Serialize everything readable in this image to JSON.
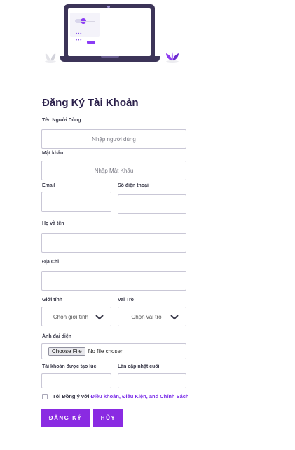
{
  "title": "Đăng Ký Tài Khoản",
  "fields": {
    "username": {
      "label": "Tên Người Dùng",
      "placeholder": "Nhập người dùng"
    },
    "password": {
      "label": "Mật khẩu",
      "placeholder": "Nhập Mật Khẩu"
    },
    "email": {
      "label": "Email",
      "value": ""
    },
    "phone": {
      "label": "Số điện thoại",
      "value": ""
    },
    "fullname": {
      "label": "Họ và tên",
      "value": ""
    },
    "address": {
      "label": "Địa Chỉ",
      "value": ""
    },
    "gender": {
      "label": "Giới tính",
      "selected": "Chọn giới tính"
    },
    "role": {
      "label": "Vai Trò",
      "selected": "Chọn vai trò"
    },
    "avatar": {
      "label": "Ảnh đại diện",
      "button": "Choose File",
      "status": "No file chosen"
    },
    "created_at": {
      "label": "Tài khoản được tạo lúc",
      "value": ""
    },
    "updated_at": {
      "label": "Lần cập nhật cuối",
      "value": ""
    }
  },
  "terms": {
    "prefix": "Tôi Đồng ý với ",
    "link": "Điều khoản, Điều Kiện, and Chính Sách",
    "checked": false
  },
  "buttons": {
    "register": "ĐĂNG KÝ",
    "cancel": "HỦY"
  },
  "colors": {
    "accent": "#8a2be2",
    "title": "#2a1f4a",
    "laptop": "#3c3458"
  },
  "icons": {
    "illustration": "laptop-illustration",
    "select": "chevron-down-icon"
  }
}
